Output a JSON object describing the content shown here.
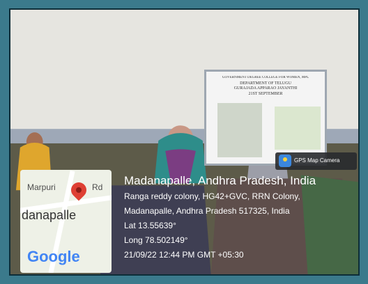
{
  "screen": {
    "line1": "GOVERNMENT DEGREE COLLEGE FOR WOMEN, MPL",
    "line2": "DEPARTMENT OF TELUGU",
    "line3": "GURAJADA APPARAO JAYANTHI",
    "line4": "21ST SEPTEMBER"
  },
  "gps_badge": {
    "label": "GPS Map Camera",
    "icon": "gps-map-camera-icon"
  },
  "map": {
    "top_left": "Marpuri",
    "top_right": "Rd",
    "city": "danapalle",
    "logo": "Google"
  },
  "overlay": {
    "title": "Madanapalle, Andhra Pradesh, India",
    "line1": "Ranga reddy colony, HG42+GVC, RRN Colony,",
    "line2": "Madanapalle, Andhra Pradesh 517325, India",
    "lat": "Lat 13.55639°",
    "long": "Long 78.502149°",
    "timestamp": "21/09/22 12:44 PM GMT +05:30"
  },
  "colors": {
    "frame": "#3b7a8c",
    "border": "#0d2d38",
    "map_pin": "#de3f33",
    "google_blue": "#4285F4"
  }
}
